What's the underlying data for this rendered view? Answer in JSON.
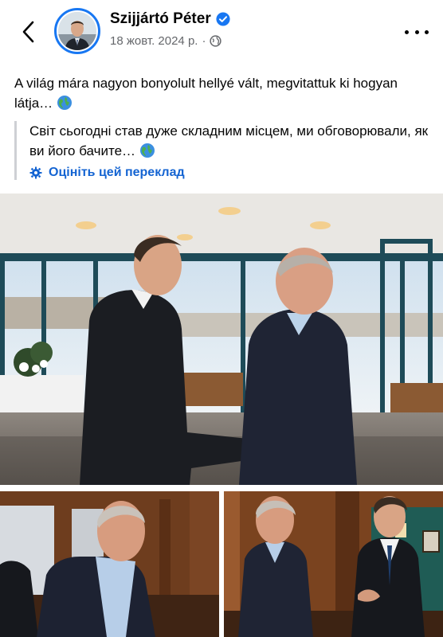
{
  "header": {
    "author_name": "Szijjártó Péter",
    "date": "18 жовт. 2024 р.",
    "separator": "·",
    "icons": {
      "back": "chevron-left-icon",
      "verified": "verified-badge-icon",
      "audience": "globe-audience-icon",
      "more": "more-dots-icon"
    }
  },
  "post": {
    "text": "A világ mára nagyon bonyolult hellyé vált, megvitattuk ki hogyan látja…",
    "translation": "Світ сьогодні став дуже складним місцем, ми обговорювали, як ви його бачите…",
    "rate_translation": "Оцініть цей переклад"
  },
  "colors": {
    "accent": "#1877f2",
    "link": "#1464d2",
    "secondary_text": "#65676b"
  }
}
